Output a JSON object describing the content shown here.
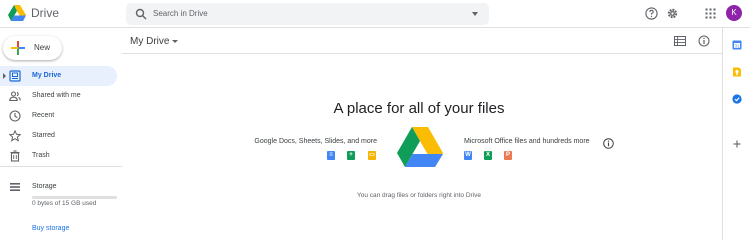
{
  "header": {
    "brand": "Drive",
    "search_placeholder": "Search in Drive",
    "avatar_initial": "K"
  },
  "sidebar": {
    "new_label": "New",
    "items": [
      {
        "label": "My Drive",
        "icon": "my-drive-icon",
        "active": true
      },
      {
        "label": "Shared with me",
        "icon": "people-icon",
        "active": false
      },
      {
        "label": "Recent",
        "icon": "clock-icon",
        "active": false
      },
      {
        "label": "Starred",
        "icon": "star-icon",
        "active": false
      },
      {
        "label": "Trash",
        "icon": "trash-icon",
        "active": false
      }
    ],
    "storage_label": "Storage",
    "storage_used_text": "0 bytes of 15 GB used",
    "storage_fraction": 0,
    "buy_storage": "Buy storage"
  },
  "main": {
    "breadcrumb": "My Drive",
    "empty_title": "A place for all of your files",
    "promo_left": "Google Docs, Sheets, Slides, and more",
    "promo_right": "Microsoft Office files and hundreds more",
    "left_apps": [
      {
        "icon": "docs-icon",
        "color": "#4285f4",
        "glyph": "≡"
      },
      {
        "icon": "sheets-icon",
        "color": "#0f9d58",
        "glyph": "+"
      },
      {
        "icon": "slides-icon",
        "color": "#f4b400",
        "glyph": "▭"
      }
    ],
    "right_apps": [
      {
        "icon": "word-icon",
        "color": "#4285f4",
        "glyph": "W"
      },
      {
        "icon": "excel-icon",
        "color": "#0f9d58",
        "glyph": "X"
      },
      {
        "icon": "powerpoint-icon",
        "color": "#ea7a52",
        "glyph": "P"
      }
    ],
    "hint": "You can drag files or folders right into Drive"
  },
  "colors": {
    "accent": "#1a73e8",
    "active_bg": "#e8f0fe",
    "avatar": "#8e24aa"
  }
}
